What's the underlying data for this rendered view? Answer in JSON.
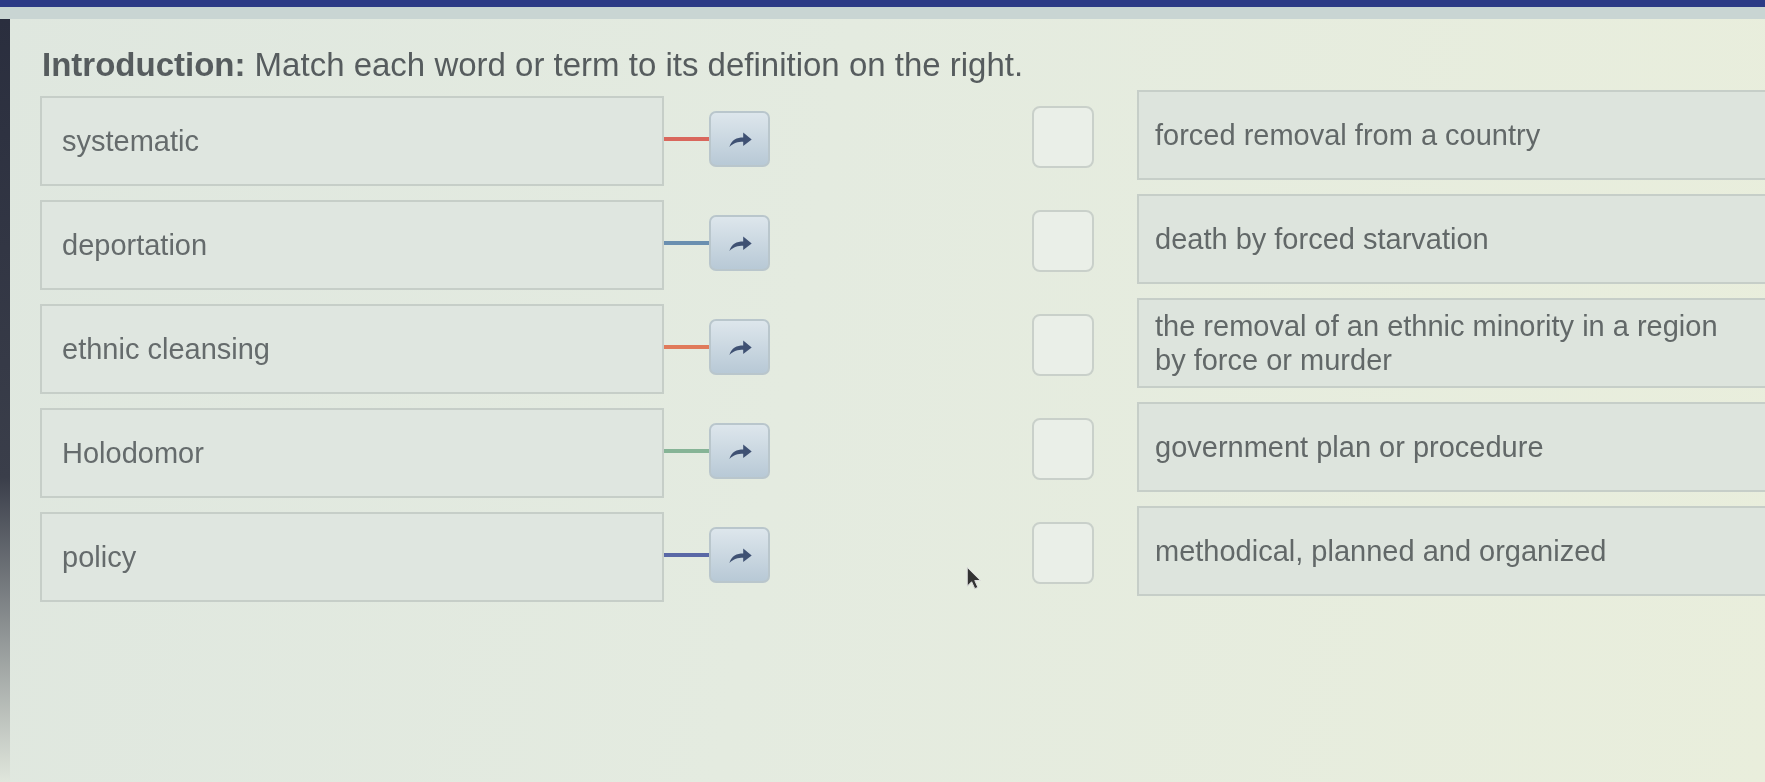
{
  "title": "**Introduction:** Match each word or term to its definition on the right.",
  "terms": [
    {
      "label": "systematic",
      "color": "#d9675c"
    },
    {
      "label": "deportation",
      "color": "#6a8fb0"
    },
    {
      "label": "ethnic cleansing",
      "color": "#e07a5a"
    },
    {
      "label": "Holodomor",
      "color": "#86b496"
    },
    {
      "label": "policy",
      "color": "#5a68a6"
    }
  ],
  "definitions": [
    {
      "text": "forced removal from a country",
      "checked": false
    },
    {
      "text": "death by forced starvation",
      "checked": false
    },
    {
      "text": "the removal of an ethnic minority in a region by force or murder",
      "checked": false
    },
    {
      "text": "government plan or procedure",
      "checked": false
    },
    {
      "text": "methodical, planned and organized",
      "checked": false
    }
  ]
}
